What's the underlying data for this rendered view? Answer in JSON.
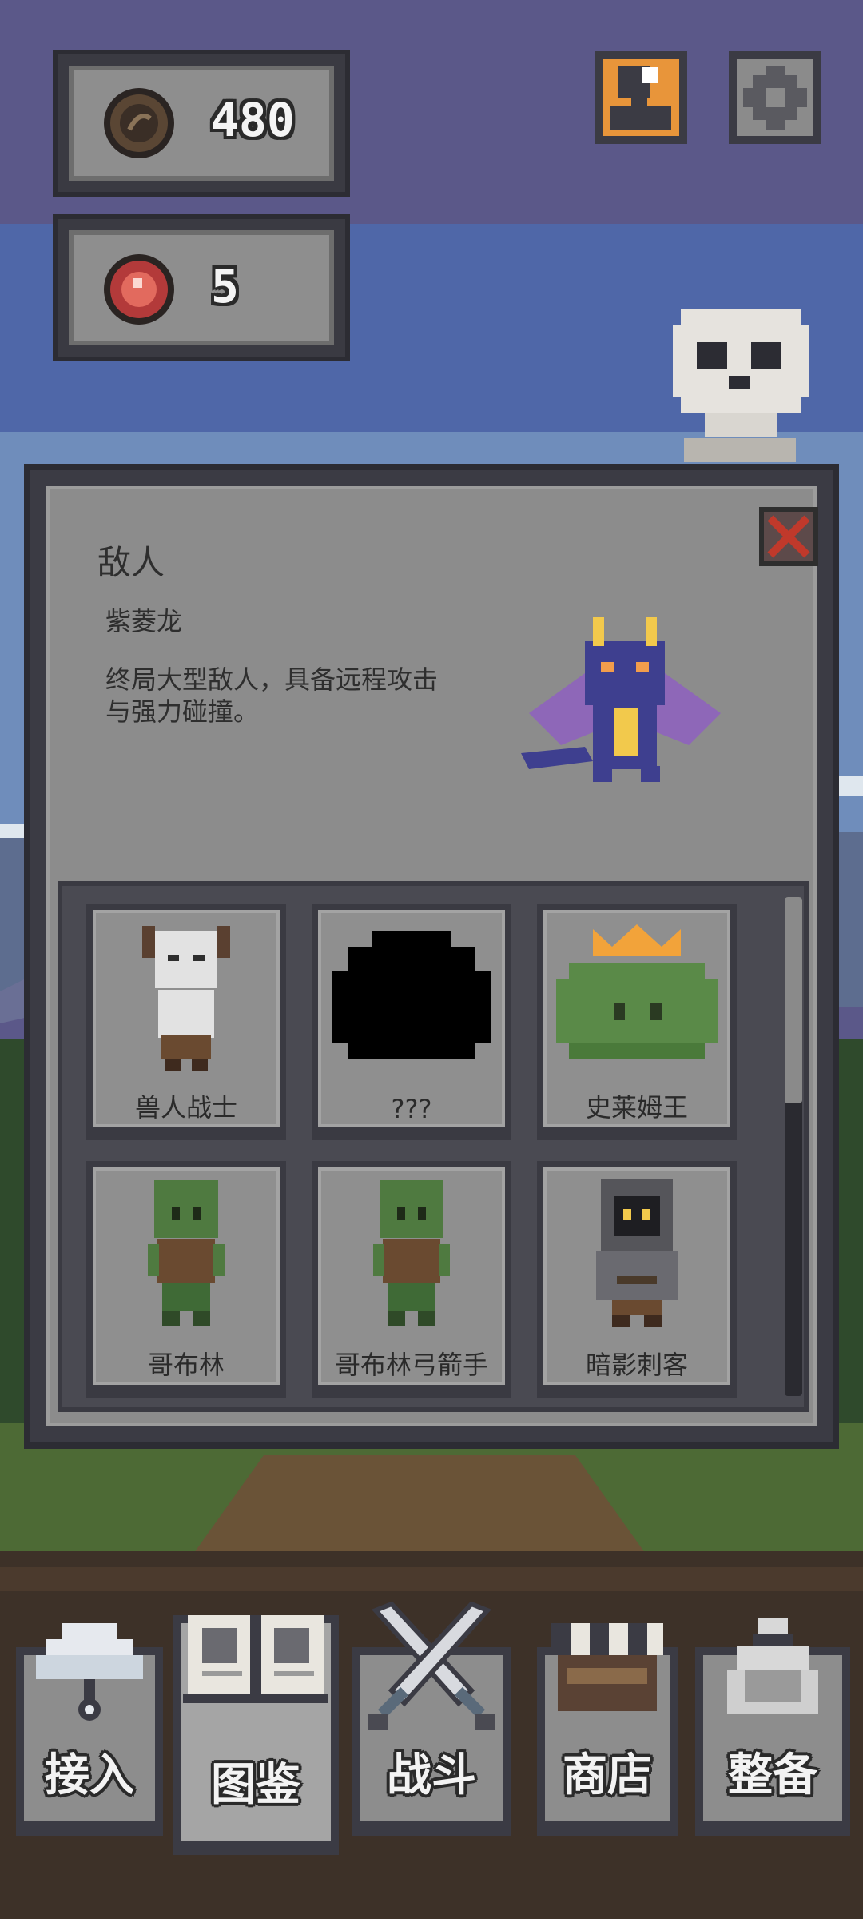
{
  "hud": {
    "coins": "480",
    "gems": "5"
  },
  "panel": {
    "title": "敌人",
    "selected_name": "紫菱龙",
    "selected_desc": "终局大型敌人，具备远程攻击与强力碰撞。"
  },
  "enemies": [
    {
      "label": "兽人战士",
      "icon": "orc-warrior-icon"
    },
    {
      "label": "???",
      "icon": "unknown-silhouette-icon"
    },
    {
      "label": "史莱姆王",
      "icon": "slime-king-icon"
    },
    {
      "label": "哥布林",
      "icon": "goblin-icon"
    },
    {
      "label": "哥布林弓箭手",
      "icon": "goblin-archer-icon"
    },
    {
      "label": "暗影刺客",
      "icon": "shadow-assassin-icon"
    }
  ],
  "nav": [
    {
      "label": "接入",
      "icon": "cloud-connect-icon"
    },
    {
      "label": "图鉴",
      "icon": "book-icon",
      "active": true
    },
    {
      "label": "战斗",
      "icon": "crossed-swords-icon"
    },
    {
      "label": "商店",
      "icon": "shop-stall-icon"
    },
    {
      "label": "整备",
      "icon": "bag-icon"
    }
  ],
  "colors": {
    "sky": "#5b5889",
    "panel": "#8c8c8c",
    "frame": "#3b3b44",
    "accent_orange": "#e8953a"
  }
}
